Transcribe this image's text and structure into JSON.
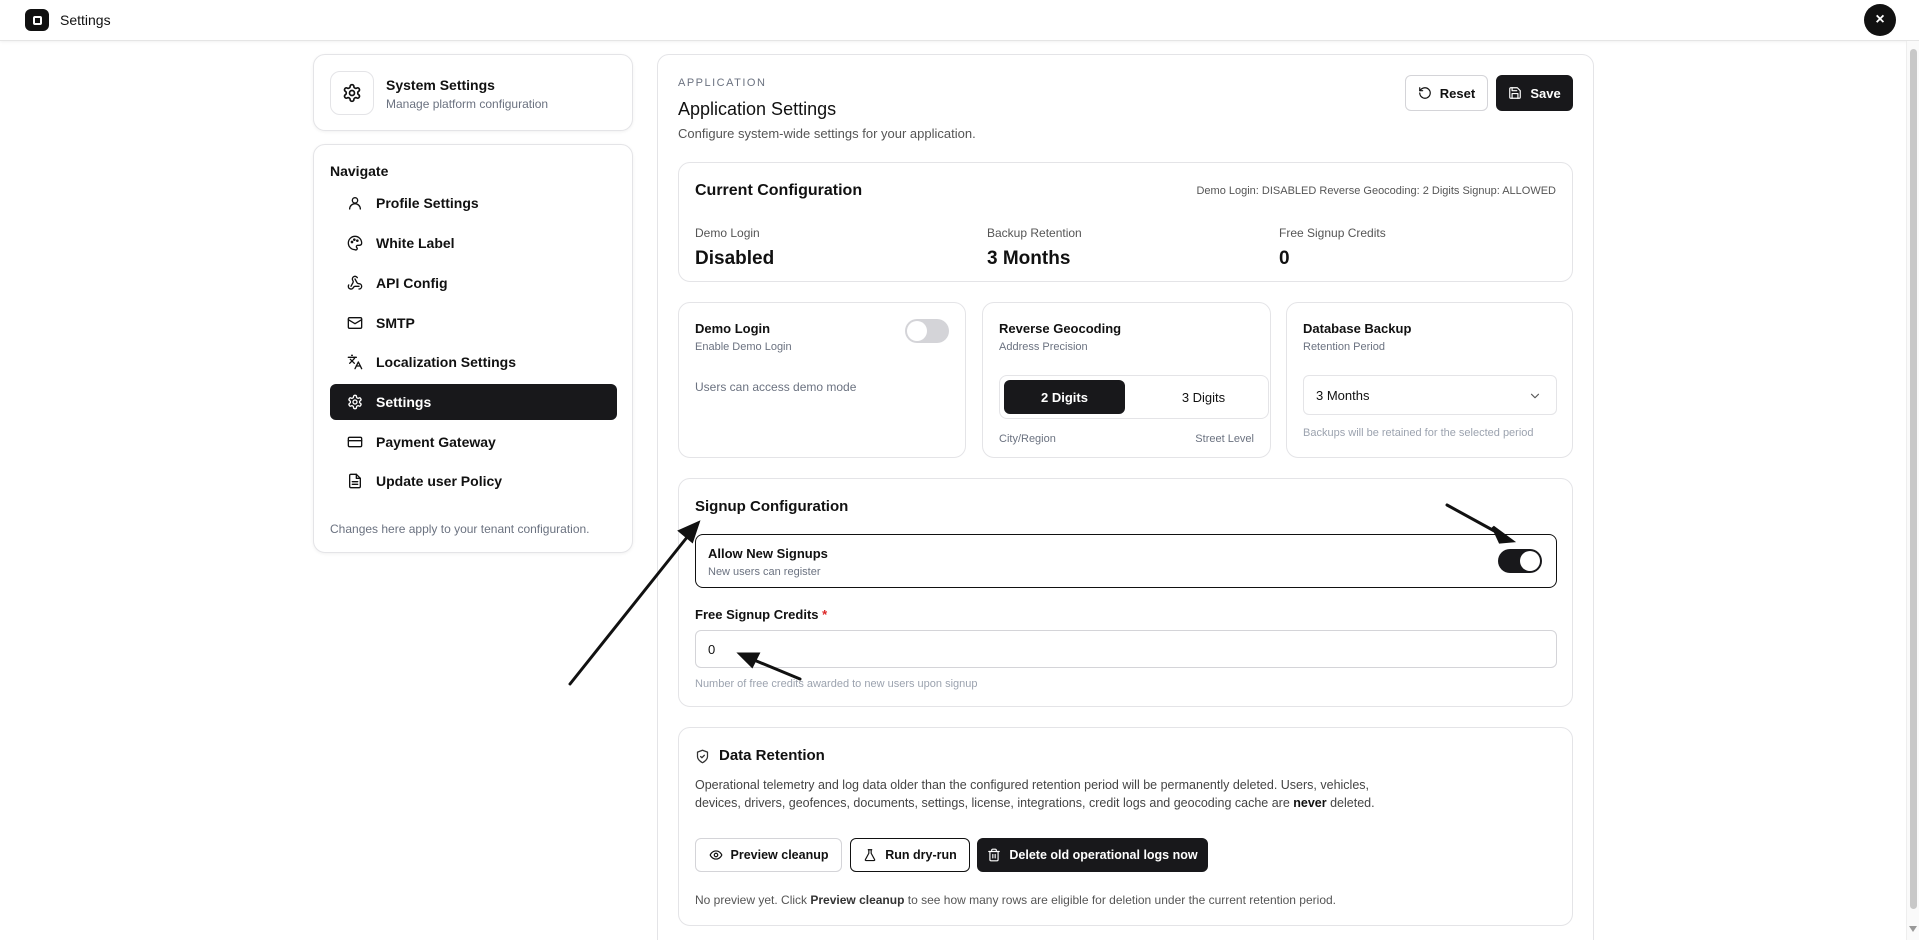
{
  "topbar": {
    "title": "Settings",
    "close_icon": "×"
  },
  "system_card": {
    "title": "System Settings",
    "subtitle": "Manage platform configuration"
  },
  "nav": {
    "heading": "Navigate",
    "items": [
      {
        "label": "Profile Settings",
        "icon": "user-icon"
      },
      {
        "label": "White Label",
        "icon": "palette-icon"
      },
      {
        "label": "API Config",
        "icon": "webhook-icon"
      },
      {
        "label": "SMTP",
        "icon": "mail-icon"
      },
      {
        "label": "Localization Settings",
        "icon": "languages-icon"
      },
      {
        "label": "Settings",
        "icon": "gear-icon",
        "active": true
      },
      {
        "label": "Payment Gateway",
        "icon": "credit-card-icon"
      },
      {
        "label": "Update user Policy",
        "icon": "file-text-icon"
      }
    ],
    "footer": "Changes here apply to your tenant configuration."
  },
  "header": {
    "eyebrow": "APPLICATION",
    "title": "Application Settings",
    "subtitle": "Configure system-wide settings for your application.",
    "reset_label": "Reset",
    "save_label": "Save"
  },
  "current_config": {
    "title": "Current Configuration",
    "summary": "Demo Login: DISABLED Reverse Geocoding: 2 Digits Signup: ALLOWED",
    "demo_login_label": "Demo Login",
    "demo_login_value": "Disabled",
    "backup_label": "Backup Retention",
    "backup_value": "3 Months",
    "credits_label": "Free Signup Credits",
    "credits_value": "0"
  },
  "demo_login": {
    "title": "Demo Login",
    "subtitle": "Enable Demo Login",
    "description": "Users can access demo mode",
    "enabled": false
  },
  "reverse_geocoding": {
    "title": "Reverse Geocoding",
    "subtitle": "Address Precision",
    "option_1": "2 Digits",
    "option_2": "3 Digits",
    "selected": "2 Digits",
    "caption_left": "City/Region",
    "caption_right": "Street Level"
  },
  "database_backup": {
    "title": "Database Backup",
    "subtitle": "Retention Period",
    "selected": "3 Months",
    "help": "Backups will be retained for the selected period"
  },
  "signup": {
    "title": "Signup Configuration",
    "allow_title": "Allow New Signups",
    "allow_subtitle": "New users can register",
    "allow_enabled": true,
    "credits_label": "Free Signup Credits",
    "required_mark": "*",
    "credits_value": "0",
    "credits_help": "Number of free credits awarded to new users upon signup"
  },
  "data_retention": {
    "title": "Data Retention",
    "desc_part1": "Operational telemetry and log data older than the configured retention period will be permanently deleted. Users, vehicles, devices, drivers, geofences, documents, settings, license, integrations, credit logs and geocoding cache are ",
    "desc_bold": "never",
    "desc_part2": " deleted.",
    "preview_label": "Preview cleanup",
    "dryrun_label": "Run dry-run",
    "delete_label": "Delete old operational logs now",
    "foot_part1": "No preview yet. Click ",
    "foot_bold": "Preview cleanup",
    "foot_part2": " to see how many rows are eligible for deletion under the current retention period."
  },
  "colors": {
    "accent": "#18181b",
    "required": "#dc2626",
    "muted": "#6b7280"
  }
}
